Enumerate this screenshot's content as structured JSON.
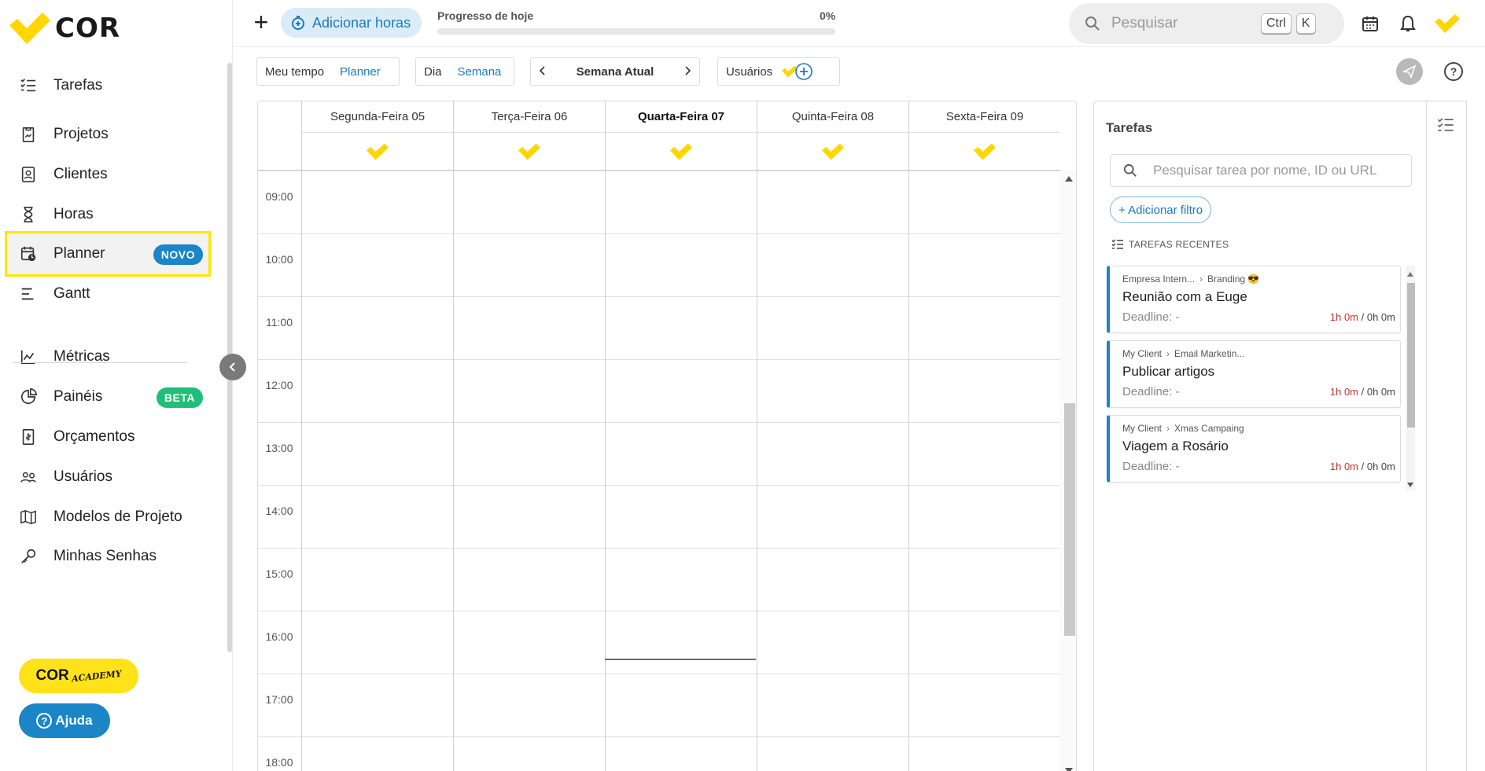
{
  "brand": {
    "name": "COR",
    "accent": "#FFD600",
    "primary": "#1A85C7"
  },
  "sidebar": {
    "items": [
      {
        "label": "Tarefas",
        "icon": "task-list-icon"
      },
      {
        "label": "Projetos",
        "icon": "clipboard-icon"
      },
      {
        "label": "Clientes",
        "icon": "contact-card-icon"
      },
      {
        "label": "Horas",
        "icon": "hourglass-icon"
      },
      {
        "label": "Planner",
        "icon": "calendar-clock-icon",
        "badge": "NOVO",
        "active": true
      },
      {
        "label": "Gantt",
        "icon": "gantt-icon"
      },
      {
        "label": "Métricas",
        "icon": "chart-icon"
      },
      {
        "label": "Painéis",
        "icon": "pie-chart-icon",
        "badge": "BETA"
      },
      {
        "label": "Orçamentos",
        "icon": "budget-icon"
      },
      {
        "label": "Usuários",
        "icon": "users-icon"
      },
      {
        "label": "Modelos de Projeto",
        "icon": "map-icon"
      },
      {
        "label": "Minhas Senhas",
        "icon": "key-icon"
      }
    ],
    "academy": {
      "main": "COR",
      "sub": "ACADEMY"
    },
    "help_label": "Ajuda"
  },
  "topbar": {
    "add_hours_label": "Adicionar horas",
    "progress": {
      "label": "Progresso de hoje",
      "value_text": "0%",
      "fraction": 0
    },
    "search": {
      "placeholder": "Pesquisar",
      "kbd1": "Ctrl",
      "kbd2": "K"
    }
  },
  "toolbar": {
    "view_tabs": [
      "Meu tempo",
      "Planner"
    ],
    "range_tabs": [
      "Dia",
      "Semana"
    ],
    "week_label": "Semana Atual",
    "users_label": "Usuários"
  },
  "calendar": {
    "days": [
      "Segunda-Feira 05",
      "Terça-Feira 06",
      "Quarta-Feira 07",
      "Quinta-Feira 08",
      "Sexta-Feira 09"
    ],
    "today_index": 2,
    "hours": [
      "09:00",
      "10:00",
      "11:00",
      "12:00",
      "13:00",
      "14:00",
      "15:00",
      "16:00",
      "17:00",
      "18:00"
    ]
  },
  "tasks": {
    "title": "Tarefas",
    "search_placeholder": "Pesquisar tarea por nome, ID ou URL",
    "filter_label": "+ Adicionar filtro",
    "recent_label": "TAREFAS RECENTES",
    "items": [
      {
        "client": "Empresa Intern...",
        "project": "Branding 😎",
        "title": "Reunião com a Euge",
        "deadline": "Deadline: -",
        "tracked": "1h 0m",
        "estimate": "/ 0h 0m"
      },
      {
        "client": "My Client",
        "project": "Email Marketin...",
        "title": "Publicar artigos",
        "deadline": "Deadline: -",
        "tracked": "1h 0m",
        "estimate": "/ 0h 0m"
      },
      {
        "client": "My Client",
        "project": "Xmas Campaing",
        "title": "Viagem a Rosário",
        "deadline": "Deadline: -",
        "tracked": "1h 0m",
        "estimate": "/ 0h 0m"
      }
    ]
  }
}
